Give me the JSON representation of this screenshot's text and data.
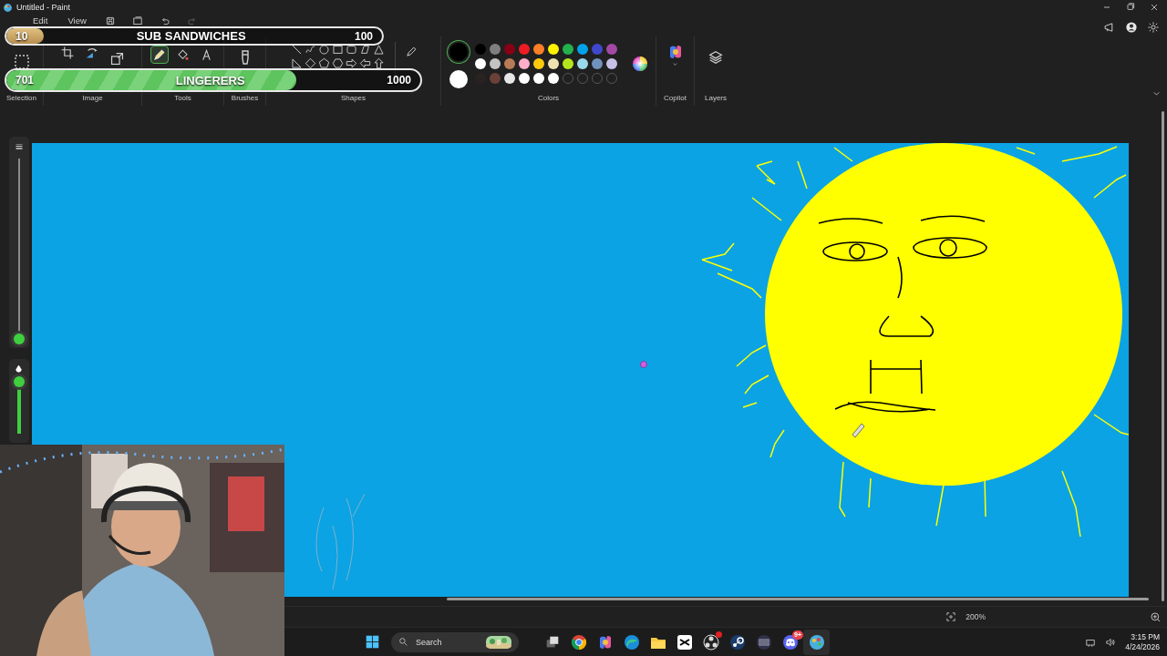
{
  "window": {
    "title": "Untitled - Paint"
  },
  "menu": [
    "Edit",
    "View"
  ],
  "ribbon_groups": [
    "Selection",
    "Image",
    "Tools",
    "Brushes",
    "Shapes",
    "Colors",
    "Copilot",
    "Layers"
  ],
  "tools": [
    {
      "kind": "pencil",
      "selected": true
    },
    {
      "kind": "fill",
      "selected": false
    },
    {
      "kind": "text",
      "selected": false
    }
  ],
  "colors": {
    "primary": {
      "color": "#000000",
      "selected": true
    },
    "secondary": {
      "color": "#ffffff",
      "selected": false
    },
    "palette": [
      {
        "kind": "swatch",
        "color": "#000000"
      },
      {
        "kind": "swatch",
        "color": "#7f7f7f"
      },
      {
        "kind": "swatch",
        "color": "#880015"
      },
      {
        "kind": "swatch",
        "color": "#ed1c24"
      },
      {
        "kind": "swatch",
        "color": "#ff7f27"
      },
      {
        "kind": "swatch",
        "color": "#fff200"
      },
      {
        "kind": "swatch",
        "color": "#22b14c"
      },
      {
        "kind": "swatch",
        "color": "#00a2e8"
      },
      {
        "kind": "swatch",
        "color": "#3f48cc"
      },
      {
        "kind": "swatch",
        "color": "#a349a4"
      },
      {
        "kind": "swatch",
        "color": "#ffffff"
      },
      {
        "kind": "swatch",
        "color": "#c3c3c3"
      },
      {
        "kind": "swatch",
        "color": "#b97a57"
      },
      {
        "kind": "swatch",
        "color": "#ffaec9"
      },
      {
        "kind": "swatch",
        "color": "#ffc90e"
      },
      {
        "kind": "swatch",
        "color": "#efe4b0"
      },
      {
        "kind": "swatch",
        "color": "#b5e61d"
      },
      {
        "kind": "swatch",
        "color": "#99d9ea"
      },
      {
        "kind": "swatch",
        "color": "#7092be"
      },
      {
        "kind": "swatch",
        "color": "#c8bfe7"
      },
      {
        "kind": "swatch",
        "color": "#2a2220"
      },
      {
        "kind": "swatch",
        "color": "#6b4038"
      },
      {
        "kind": "swatch",
        "color": "#e6e6e6"
      },
      {
        "kind": "swatch",
        "color": "#ffffff"
      },
      {
        "kind": "swatch",
        "color": "#ffffff"
      },
      {
        "kind": "swatch",
        "color": "#ffffff"
      },
      {
        "kind": "empty"
      },
      {
        "kind": "empty"
      },
      {
        "kind": "empty"
      },
      {
        "kind": "empty"
      }
    ]
  },
  "goal_bars": [
    {
      "current": "10",
      "label": "SUB SANDWICHES",
      "target": "100",
      "level": 0.1,
      "kind": "plain"
    },
    {
      "current": "701",
      "label": "LINGERERS",
      "target": "1000",
      "level": 0.701,
      "kind": "striped"
    }
  ],
  "canvas_sliders": [
    {
      "kind": "size",
      "level": 0
    },
    {
      "kind": "opacity",
      "level": 1
    }
  ],
  "status_bar": {
    "zoom": "200%"
  },
  "taskbar": {
    "search_placeholder": "Search",
    "notification_badge": "9+",
    "time": "3:15 PM",
    "date": "4/24/2026"
  }
}
